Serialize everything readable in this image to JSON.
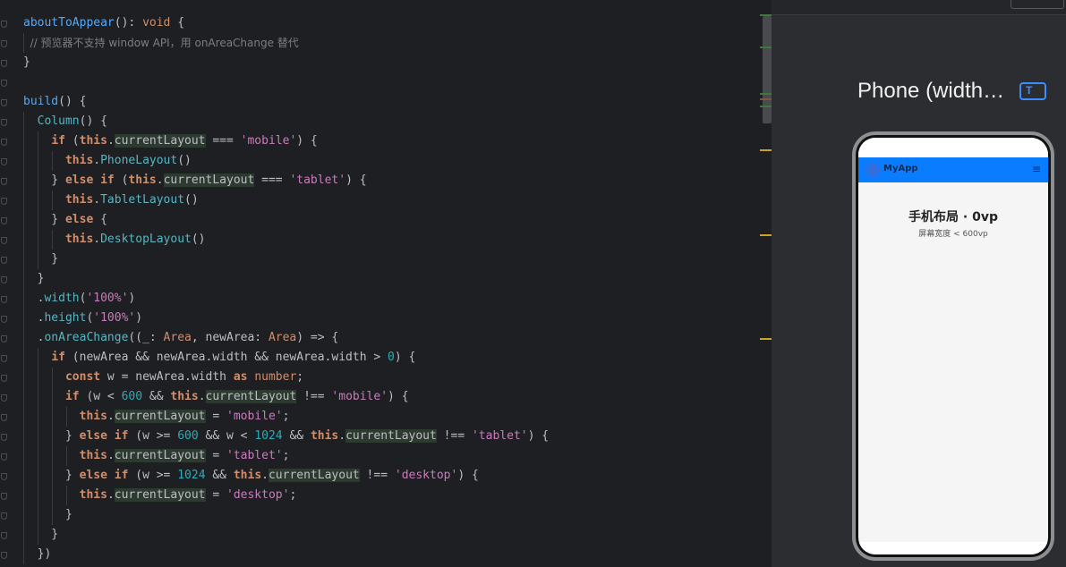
{
  "editor": {
    "lines": [
      [
        {
          "t": "aboutToAppear",
          "c": "fn"
        },
        {
          "t": "(): ",
          "c": "id"
        },
        {
          "t": "void",
          "c": "kw"
        },
        {
          "t": " {",
          "c": "id"
        }
      ],
      [
        {
          "t": "  // ",
          "c": "cm"
        },
        {
          "t": "预览器不支持 window API，用 onAreaChange 替代",
          "c": "cm"
        }
      ],
      [
        {
          "t": "}",
          "c": "id"
        }
      ],
      [],
      [
        {
          "t": "build",
          "c": "fn"
        },
        {
          "t": "() {",
          "c": "id"
        }
      ],
      [
        {
          "t": "  ",
          "c": "id"
        },
        {
          "t": "Column",
          "c": "mt"
        },
        {
          "t": "() {",
          "c": "id"
        }
      ],
      [
        {
          "t": "    ",
          "c": "id"
        },
        {
          "t": "if",
          "c": "kw"
        },
        {
          "t": " (",
          "c": "id"
        },
        {
          "t": "this",
          "c": "kw"
        },
        {
          "t": ".",
          "c": "id"
        },
        {
          "t": "currentLayout",
          "c": "id hl"
        },
        {
          "t": " === ",
          "c": "id"
        },
        {
          "t": "'mobile'",
          "c": "st"
        },
        {
          "t": ") {",
          "c": "id"
        }
      ],
      [
        {
          "t": "      ",
          "c": "id"
        },
        {
          "t": "this",
          "c": "kw"
        },
        {
          "t": ".",
          "c": "id"
        },
        {
          "t": "PhoneLayout",
          "c": "mt"
        },
        {
          "t": "()",
          "c": "id"
        }
      ],
      [
        {
          "t": "    } ",
          "c": "id"
        },
        {
          "t": "else if",
          "c": "kw"
        },
        {
          "t": " (",
          "c": "id"
        },
        {
          "t": "this",
          "c": "kw"
        },
        {
          "t": ".",
          "c": "id"
        },
        {
          "t": "currentLayout",
          "c": "id hl"
        },
        {
          "t": " === ",
          "c": "id"
        },
        {
          "t": "'tablet'",
          "c": "st"
        },
        {
          "t": ") {",
          "c": "id"
        }
      ],
      [
        {
          "t": "      ",
          "c": "id"
        },
        {
          "t": "this",
          "c": "kw"
        },
        {
          "t": ".",
          "c": "id"
        },
        {
          "t": "TabletLayout",
          "c": "mt"
        },
        {
          "t": "()",
          "c": "id"
        }
      ],
      [
        {
          "t": "    } ",
          "c": "id"
        },
        {
          "t": "else",
          "c": "kw"
        },
        {
          "t": " {",
          "c": "id"
        }
      ],
      [
        {
          "t": "      ",
          "c": "id"
        },
        {
          "t": "this",
          "c": "kw"
        },
        {
          "t": ".",
          "c": "id"
        },
        {
          "t": "DesktopLayout",
          "c": "mt"
        },
        {
          "t": "()",
          "c": "id"
        }
      ],
      [
        {
          "t": "    }",
          "c": "id"
        }
      ],
      [
        {
          "t": "  }",
          "c": "id"
        }
      ],
      [
        {
          "t": "  .",
          "c": "id"
        },
        {
          "t": "width",
          "c": "mt"
        },
        {
          "t": "(",
          "c": "id"
        },
        {
          "t": "'100%'",
          "c": "st"
        },
        {
          "t": ")",
          "c": "id"
        }
      ],
      [
        {
          "t": "  .",
          "c": "id"
        },
        {
          "t": "height",
          "c": "mt"
        },
        {
          "t": "(",
          "c": "id"
        },
        {
          "t": "'100%'",
          "c": "st"
        },
        {
          "t": ")",
          "c": "id"
        }
      ],
      [
        {
          "t": "  .",
          "c": "id"
        },
        {
          "t": "onAreaChange",
          "c": "mt"
        },
        {
          "t": "((_: ",
          "c": "id"
        },
        {
          "t": "Area",
          "c": "ty"
        },
        {
          "t": ", newArea: ",
          "c": "id"
        },
        {
          "t": "Area",
          "c": "ty"
        },
        {
          "t": ") => {",
          "c": "id"
        }
      ],
      [
        {
          "t": "    ",
          "c": "id"
        },
        {
          "t": "if",
          "c": "kw"
        },
        {
          "t": " (newArea && newArea.width && newArea.width > ",
          "c": "id"
        },
        {
          "t": "0",
          "c": "num"
        },
        {
          "t": ") {",
          "c": "id"
        }
      ],
      [
        {
          "t": "      ",
          "c": "id"
        },
        {
          "t": "const",
          "c": "kw"
        },
        {
          "t": " w = newArea.width ",
          "c": "id"
        },
        {
          "t": "as",
          "c": "kw"
        },
        {
          "t": " ",
          "c": "id"
        },
        {
          "t": "number",
          "c": "ty"
        },
        {
          "t": ";",
          "c": "id"
        }
      ],
      [
        {
          "t": "      ",
          "c": "id"
        },
        {
          "t": "if",
          "c": "kw"
        },
        {
          "t": " (w < ",
          "c": "id"
        },
        {
          "t": "600",
          "c": "num"
        },
        {
          "t": " && ",
          "c": "id"
        },
        {
          "t": "this",
          "c": "kw"
        },
        {
          "t": ".",
          "c": "id"
        },
        {
          "t": "currentLayout",
          "c": "id hl"
        },
        {
          "t": " !== ",
          "c": "id"
        },
        {
          "t": "'mobile'",
          "c": "st"
        },
        {
          "t": ") {",
          "c": "id"
        }
      ],
      [
        {
          "t": "        ",
          "c": "id"
        },
        {
          "t": "this",
          "c": "kw"
        },
        {
          "t": ".",
          "c": "id"
        },
        {
          "t": "currentLayout",
          "c": "id hl"
        },
        {
          "t": " = ",
          "c": "id"
        },
        {
          "t": "'mobile'",
          "c": "st"
        },
        {
          "t": ";",
          "c": "id"
        }
      ],
      [
        {
          "t": "      } ",
          "c": "id"
        },
        {
          "t": "else if",
          "c": "kw"
        },
        {
          "t": " (w >= ",
          "c": "id"
        },
        {
          "t": "600",
          "c": "num"
        },
        {
          "t": " && w < ",
          "c": "id"
        },
        {
          "t": "1024",
          "c": "num"
        },
        {
          "t": " && ",
          "c": "id"
        },
        {
          "t": "this",
          "c": "kw"
        },
        {
          "t": ".",
          "c": "id"
        },
        {
          "t": "currentLayout",
          "c": "id hl"
        },
        {
          "t": " !== ",
          "c": "id"
        },
        {
          "t": "'tablet'",
          "c": "st"
        },
        {
          "t": ") {",
          "c": "id"
        }
      ],
      [
        {
          "t": "        ",
          "c": "id"
        },
        {
          "t": "this",
          "c": "kw"
        },
        {
          "t": ".",
          "c": "id"
        },
        {
          "t": "currentLayout",
          "c": "id hl"
        },
        {
          "t": " = ",
          "c": "id"
        },
        {
          "t": "'tablet'",
          "c": "st"
        },
        {
          "t": ";",
          "c": "id"
        }
      ],
      [
        {
          "t": "      } ",
          "c": "id"
        },
        {
          "t": "else if",
          "c": "kw"
        },
        {
          "t": " (w >= ",
          "c": "id"
        },
        {
          "t": "1024",
          "c": "num"
        },
        {
          "t": " && ",
          "c": "id"
        },
        {
          "t": "this",
          "c": "kw"
        },
        {
          "t": ".",
          "c": "id"
        },
        {
          "t": "currentLayout",
          "c": "id hl"
        },
        {
          "t": " !== ",
          "c": "id"
        },
        {
          "t": "'desktop'",
          "c": "st"
        },
        {
          "t": ") {",
          "c": "id"
        }
      ],
      [
        {
          "t": "        ",
          "c": "id"
        },
        {
          "t": "this",
          "c": "kw"
        },
        {
          "t": ".",
          "c": "id"
        },
        {
          "t": "currentLayout",
          "c": "id hl"
        },
        {
          "t": " = ",
          "c": "id"
        },
        {
          "t": "'desktop'",
          "c": "st"
        },
        {
          "t": ";",
          "c": "id"
        }
      ],
      [
        {
          "t": "      }",
          "c": "id"
        }
      ],
      [
        {
          "t": "    }",
          "c": "id"
        }
      ],
      [
        {
          "t": "  })",
          "c": "id"
        }
      ]
    ]
  },
  "preview": {
    "title": "Phone (width…",
    "toggle_icon": "T",
    "app": {
      "name": "MyApp",
      "menu_icon": "≡",
      "layout_title": "手机布局 · 0vp",
      "layout_subtitle": "屏幕宽度 < 600vp"
    }
  },
  "colors": {
    "editor_bg": "#1e1f22",
    "preview_bg": "#2b2d30",
    "app_bar": "#0a7cff",
    "accent": "#3c8dff"
  }
}
